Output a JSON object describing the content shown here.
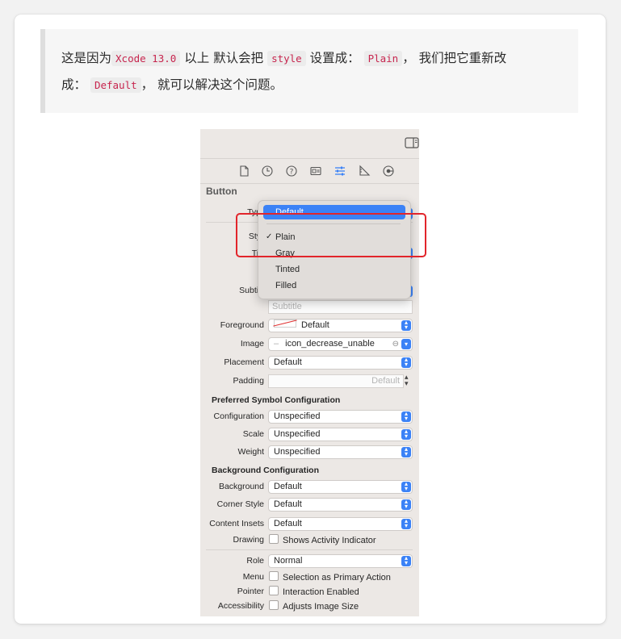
{
  "article": {
    "p1": "这是因为",
    "code1": "Xcode 13.0",
    "p2": " 以上 默认会把 ",
    "code2": "style",
    "p3": " 设置成： ",
    "code3": "Plain",
    "p4": "， 我们把它重新改",
    "p5": "成： ",
    "code4": "Default",
    "p6": "， 就可以解决这个问题。"
  },
  "inspector": {
    "section_title": "Button",
    "labels": {
      "type": "Typ",
      "style": "Sty",
      "title": "Tit",
      "subtitle": "Subtit",
      "foreground": "Foreground",
      "image": "Image",
      "placement": "Placement",
      "padding": "Padding",
      "configuration": "Configuration",
      "scale": "Scale",
      "weight": "Weight",
      "background": "Background",
      "corner_style": "Corner Style",
      "content_insets": "Content Insets",
      "drawing": "Drawing",
      "role": "Role",
      "menu": "Menu",
      "pointer": "Pointer",
      "accessibility": "Accessibility"
    },
    "values": {
      "subtitle_placeholder": "Subtitle",
      "foreground": "Default",
      "image": "icon_decrease_unable",
      "placement": "Default",
      "padding_placeholder": "Default",
      "configuration": "Unspecified",
      "scale": "Unspecified",
      "weight": "Unspecified",
      "background": "Default",
      "corner_style": "Default",
      "content_insets": "Default",
      "role": "Normal"
    },
    "subheads": {
      "symbol_config": "Preferred Symbol Configuration",
      "background_config": "Background Configuration"
    },
    "checkboxes": {
      "drawing": "Shows Activity Indicator",
      "menu": "Selection as Primary Action",
      "pointer": "Interaction Enabled",
      "accessibility": "Adjusts Image Size"
    },
    "menu": {
      "items": [
        "Default",
        "Plain",
        "Gray",
        "Tinted",
        "Filled"
      ],
      "selected_hover": "Default",
      "checked": "Plain"
    }
  },
  "colors": {
    "highlight": "#e2252b",
    "accent": "#3b82f6",
    "code_text": "#c7254e"
  }
}
